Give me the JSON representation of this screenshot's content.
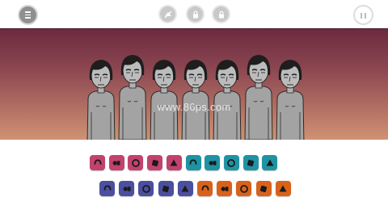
{
  "topbar": {
    "menu_icon": "menu-icon",
    "controls": [
      "no-record-icon",
      "lock-icon",
      "lock-icon"
    ],
    "pause_icon": "pause-icon"
  },
  "stage": {
    "watermark": "www.86ps.com",
    "singer_count": 7
  },
  "palette": {
    "row1": [
      {
        "icon": "beat-icon-1",
        "color": "#c2426e"
      },
      {
        "icon": "beat-icon-2",
        "color": "#c2426e"
      },
      {
        "icon": "beat-icon-3",
        "color": "#c2426e"
      },
      {
        "icon": "beat-icon-4",
        "color": "#c2426e"
      },
      {
        "icon": "beat-icon-5",
        "color": "#c2426e"
      },
      {
        "icon": "effect-icon-1",
        "color": "#1f93a3"
      },
      {
        "icon": "effect-icon-2",
        "color": "#1f93a3"
      },
      {
        "icon": "effect-icon-3",
        "color": "#1f93a3"
      },
      {
        "icon": "effect-icon-4",
        "color": "#1f93a3"
      },
      {
        "icon": "effect-icon-5",
        "color": "#1f93a3"
      }
    ],
    "row2": [
      {
        "icon": "melody-icon-1",
        "color": "#4b4fa0"
      },
      {
        "icon": "melody-icon-2",
        "color": "#4b4fa0"
      },
      {
        "icon": "melody-icon-3",
        "color": "#4b4fa0"
      },
      {
        "icon": "melody-icon-4",
        "color": "#4b4fa0"
      },
      {
        "icon": "melody-icon-5",
        "color": "#4b4fa0"
      },
      {
        "icon": "voice-icon-1",
        "color": "#d9621b"
      },
      {
        "icon": "voice-icon-2",
        "color": "#d9621b"
      },
      {
        "icon": "voice-icon-3",
        "color": "#d9621b"
      },
      {
        "icon": "voice-icon-4",
        "color": "#d9621b"
      },
      {
        "icon": "voice-icon-5",
        "color": "#d9621b"
      }
    ]
  }
}
